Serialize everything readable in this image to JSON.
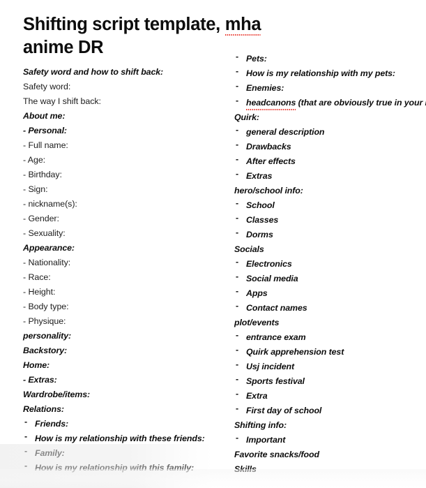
{
  "document": {
    "title_part1": "Shifting script template, ",
    "title_misspelled_word": "mha",
    "title_part2": "\nanime DR",
    "title_full": "Shifting script template, mha anime DR",
    "spellcheck_color": "#e8342a"
  },
  "left_column": {
    "items": [
      {
        "text": "Safety word and how to shift back:",
        "style": "bold-italic",
        "bullet": "none"
      },
      {
        "text": "Safety word:",
        "style": "plain",
        "bullet": "none"
      },
      {
        "text": "The way I shift back:",
        "style": "plain",
        "bullet": "none"
      },
      {
        "text": "About me:",
        "style": "bold-italic",
        "bullet": "none"
      },
      {
        "text": "- Personal:",
        "style": "bold-italic",
        "bullet": "none"
      },
      {
        "text": "- Full name:",
        "style": "plain",
        "bullet": "none"
      },
      {
        "text": "- Age:",
        "style": "plain",
        "bullet": "none"
      },
      {
        "text": "- Birthday:",
        "style": "plain",
        "bullet": "none"
      },
      {
        "text": "- Sign:",
        "style": "plain",
        "bullet": "none"
      },
      {
        "text": "- nickname(s):",
        "style": "plain",
        "bullet": "none"
      },
      {
        "text": "- Gender:",
        "style": "plain",
        "bullet": "none"
      },
      {
        "text": "- Sexuality:",
        "style": "plain",
        "bullet": "none"
      },
      {
        "text": "Appearance:",
        "style": "bold-italic",
        "bullet": "none"
      },
      {
        "text": "- Nationality:",
        "style": "plain",
        "bullet": "none"
      },
      {
        "text": "- Race:",
        "style": "plain",
        "bullet": "none"
      },
      {
        "text": "- Height:",
        "style": "plain",
        "bullet": "none"
      },
      {
        "text": "- Body type:",
        "style": "plain",
        "bullet": "none"
      },
      {
        "text": "- Physique:",
        "style": "plain",
        "bullet": "none"
      },
      {
        "text": "personality:",
        "style": "bold-italic",
        "bullet": "none"
      },
      {
        "text": "Backstory:",
        "style": "bold-italic",
        "bullet": "none"
      },
      {
        "text": "Home:",
        "style": "bold-italic",
        "bullet": "none"
      },
      {
        "text": "- Extras:",
        "style": "bold-italic",
        "bullet": "none"
      },
      {
        "text": "Wardrobe/items:",
        "style": "bold-italic",
        "bullet": "none"
      },
      {
        "text": "Relations:",
        "style": "bold-italic",
        "bullet": "none"
      },
      {
        "text": "Friends:",
        "style": "bold-italic",
        "bullet": "dash"
      },
      {
        "text": "How is my relationship with these friends:",
        "style": "bold-italic",
        "bullet": "dash"
      },
      {
        "text": "Family:",
        "style": "bold-italic",
        "bullet": "dash"
      },
      {
        "text": "How is my relationship with this family:",
        "style": "bold-italic",
        "bullet": "dash"
      }
    ]
  },
  "right_column": {
    "items": [
      {
        "text": "Pets:",
        "style": "bold-italic",
        "bullet": "dash"
      },
      {
        "text": "How is my relationship with my pets:",
        "style": "bold-italic",
        "bullet": "dash"
      },
      {
        "text": "Enemies:",
        "style": "bold-italic",
        "bullet": "dash"
      },
      {
        "text": "headcanons (that are obviously true in your DR):",
        "style": "bold-italic",
        "bullet": "dash",
        "misspelled_prefix": "headcanons"
      },
      {
        "text": "Quirk:",
        "style": "bold-italic",
        "bullet": "none"
      },
      {
        "text": "general description",
        "style": "bold-italic",
        "bullet": "dash"
      },
      {
        "text": "Drawbacks",
        "style": "bold-italic",
        "bullet": "dash"
      },
      {
        "text": "After effects",
        "style": "bold-italic",
        "bullet": "dash"
      },
      {
        "text": "Extras",
        "style": "bold-italic",
        "bullet": "dash"
      },
      {
        "text": "hero/school info:",
        "style": "bold-italic",
        "bullet": "none"
      },
      {
        "text": "School",
        "style": "bold-italic",
        "bullet": "dash"
      },
      {
        "text": "Classes",
        "style": "bold-italic",
        "bullet": "dash"
      },
      {
        "text": "Dorms",
        "style": "bold-italic",
        "bullet": "dash"
      },
      {
        "text": "Socials",
        "style": "bold-italic",
        "bullet": "none"
      },
      {
        "text": "Electronics",
        "style": "bold-italic",
        "bullet": "dash"
      },
      {
        "text": "Social media",
        "style": "bold-italic",
        "bullet": "dash"
      },
      {
        "text": "Apps",
        "style": "bold-italic",
        "bullet": "dash"
      },
      {
        "text": "Contact names",
        "style": "bold-italic",
        "bullet": "dash"
      },
      {
        "text": "plot/events",
        "style": "bold-italic",
        "bullet": "none"
      },
      {
        "text": "entrance exam",
        "style": "bold-italic",
        "bullet": "dash"
      },
      {
        "text": "Quirk apprehension test",
        "style": "bold-italic",
        "bullet": "dash"
      },
      {
        "text": "Usj incident",
        "style": "bold-italic",
        "bullet": "dash"
      },
      {
        "text": "Sports festival",
        "style": "bold-italic",
        "bullet": "dash"
      },
      {
        "text": "Extra",
        "style": "bold-italic",
        "bullet": "dash"
      },
      {
        "text": "First day of school",
        "style": "bold-italic",
        "bullet": "dash"
      },
      {
        "text": "Shifting info:",
        "style": "bold-italic",
        "bullet": "none"
      },
      {
        "text": "Important",
        "style": "bold-italic",
        "bullet": "dash"
      },
      {
        "text": "Favorite snacks/food",
        "style": "bold-italic",
        "bullet": "none"
      },
      {
        "text": "Skills",
        "style": "bold-italic",
        "bullet": "none"
      }
    ]
  },
  "glyphs": {
    "dash_bullet": "-"
  }
}
